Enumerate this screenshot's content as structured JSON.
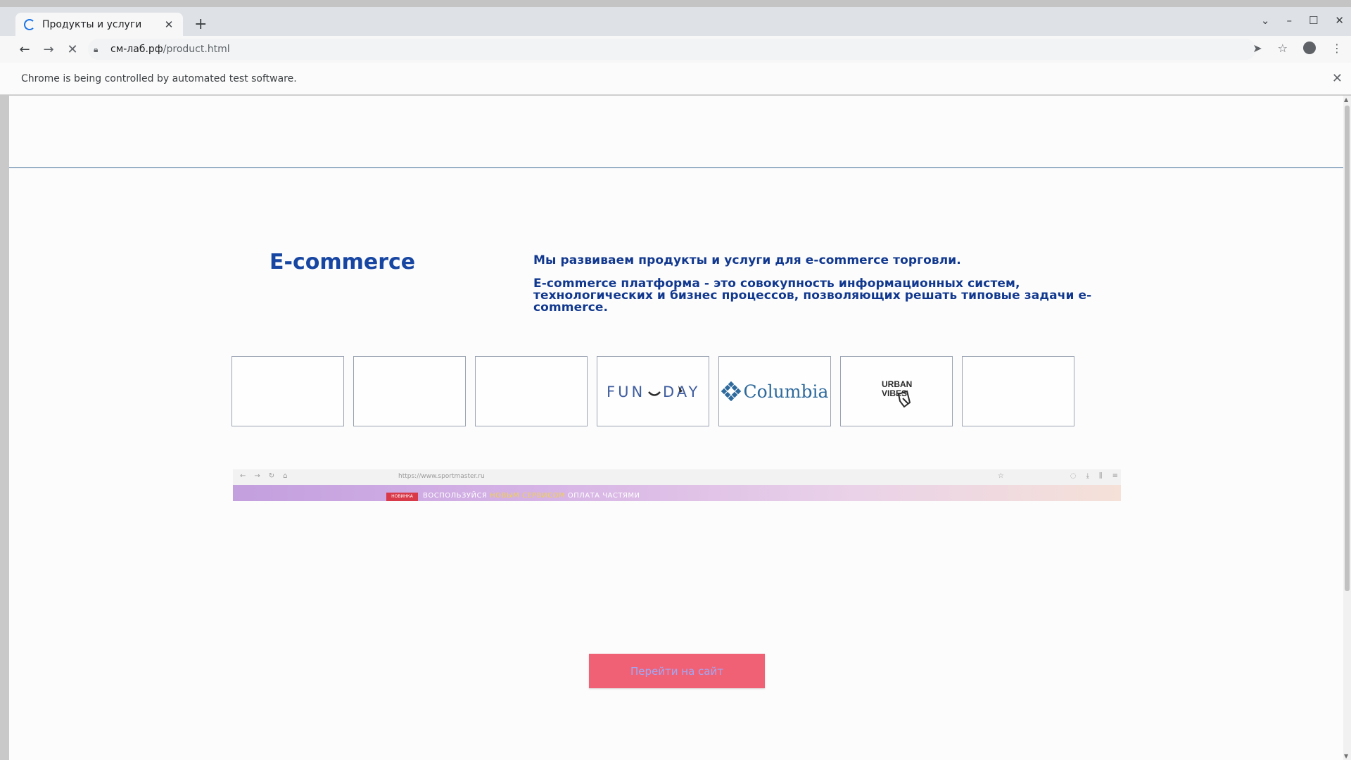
{
  "browser": {
    "tab_title": "Продукты и услуги",
    "url_host": "см-лаб.рф",
    "url_path": "/product.html",
    "infobar_text": "Chrome is being controlled by automated test software."
  },
  "page": {
    "section_title": "E-commerce",
    "description_1": "Мы развиваем продукты и услуги для e-commerce торговли.",
    "description_2": "E-commerce платформа - это совокупность информационных систем, технологических и бизнес процессов, позволяющих решать типовые задачи e-commerce.",
    "brand_logos": [
      "",
      "",
      "",
      "FUNDAY",
      "Columbia",
      "URBAN VIBES",
      ""
    ],
    "preview": {
      "url": "https://www.sportmaster.ru",
      "banner_badge": "НОВИНКА",
      "banner_text_1": "ВОСПОЛЬЗУЙСЯ ",
      "banner_text_highlight": "НОВЫМ СЕРВИСОМ",
      "banner_text_2": " ОПЛАТА ЧАСТЯМИ"
    },
    "cta_button": "Перейти на сайт"
  },
  "colors": {
    "accent_blue": "#1746a2",
    "cta_background": "#f16176"
  }
}
